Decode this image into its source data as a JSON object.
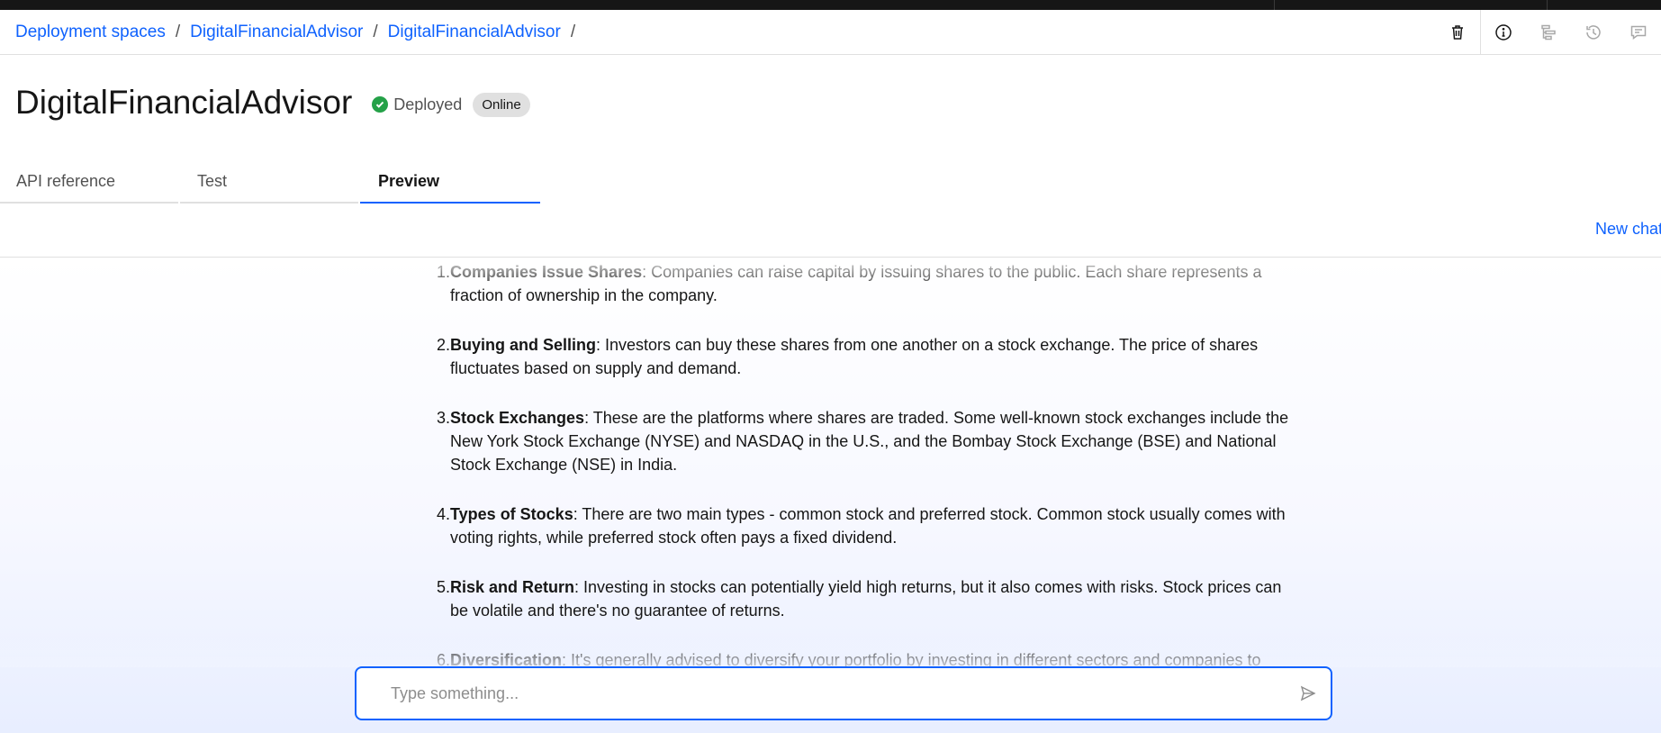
{
  "breadcrumb": {
    "items": [
      "Deployment spaces",
      "DigitalFinancialAdvisor",
      "DigitalFinancialAdvisor"
    ],
    "separator": "/"
  },
  "header_icons": [
    "trash-icon",
    "info-icon",
    "tree-structure-icon",
    "history-icon",
    "chat-icon"
  ],
  "page": {
    "title": "DigitalFinancialAdvisor",
    "status": "Deployed",
    "status_color": "#24a148",
    "badge": "Online"
  },
  "tabs": [
    {
      "label": "API reference",
      "active": false
    },
    {
      "label": "Test",
      "active": false
    },
    {
      "label": "Preview",
      "active": true
    }
  ],
  "chat": {
    "new_chat_label": "New chat",
    "messages": [
      {
        "num": "1.",
        "title": "Companies Issue Shares",
        "text": ": Companies can raise capital by issuing shares to the public. Each share represents a fraction of ownership in the company."
      },
      {
        "num": "2.",
        "title": "Buying and Selling",
        "text": ": Investors can buy these shares from one another on a stock exchange. The price of shares fluctuates based on supply and demand."
      },
      {
        "num": "3.",
        "title": "Stock Exchanges",
        "text": ": These are the platforms where shares are traded. Some well-known stock exchanges include the New York Stock Exchange (NYSE) and NASDAQ in the U.S., and the Bombay Stock Exchange (BSE) and National Stock Exchange (NSE) in India."
      },
      {
        "num": "4.",
        "title": "Types of Stocks",
        "text": ": There are two main types - common stock and preferred stock. Common stock usually comes with voting rights, while preferred stock often pays a fixed dividend."
      },
      {
        "num": "5.",
        "title": "Risk and Return",
        "text": ": Investing in stocks can potentially yield high returns, but it also comes with risks. Stock prices can be volatile and there's no guarantee of returns."
      },
      {
        "num": "6.",
        "title": "Diversification",
        "text": ": It's generally advised to diversify your portfolio by investing in different sectors and companies to spread"
      }
    ],
    "input_placeholder": "Type something..."
  },
  "colors": {
    "accent": "#0f62fe",
    "topbar": "#161616"
  }
}
